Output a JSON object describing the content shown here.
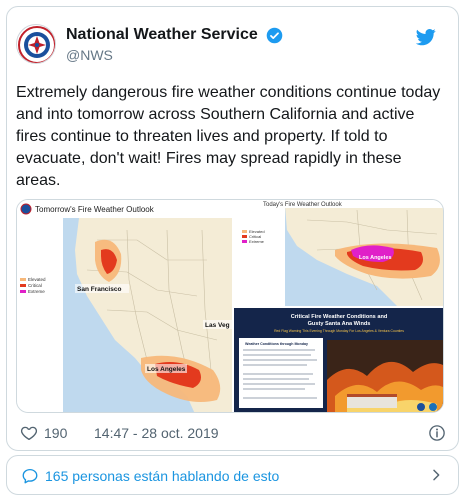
{
  "tweet": {
    "author_name": "National Weather Service",
    "handle": "@NWS",
    "text": "Extremely dangerous fire weather conditions continue today and into tomorrow across Southern California and active fires continue to threaten lives and property. If told to evacuate, don't wait! Fires may spread rapidly in these areas.",
    "likes": "190",
    "timestamp": "14:47 - 28 oct. 2019"
  },
  "media": {
    "left_map": {
      "title": "Tomorrow's Fire Weather Outlook",
      "legend": [
        "Elevated",
        "Critical",
        "Extreme"
      ],
      "city_labels": [
        "San Francisco",
        "Los Angeles",
        "Las Veg"
      ]
    },
    "right_top_map": {
      "title": "Today's Fire Weather Outlook",
      "legend": [
        "Elevated",
        "Critical",
        "Extreme"
      ],
      "city_label": "Los Angeles"
    },
    "infographic": {
      "title_line1": "Critical Fire Weather Conditions and",
      "title_line2": "Gusty Santa Ana Winds",
      "subtitle": "Red Flag Warning This Evening Through Monday For Los Angeles & Ventura Counties",
      "box_title": "Weather Conditions through Monday"
    }
  },
  "conversation": {
    "label": "165 personas están hablando de esto"
  },
  "colors": {
    "elevated": "#f7b87a",
    "critical": "#e33a1e",
    "extreme": "#e020c8",
    "link": "#1b95e0",
    "verified": "#1d9bf0"
  }
}
